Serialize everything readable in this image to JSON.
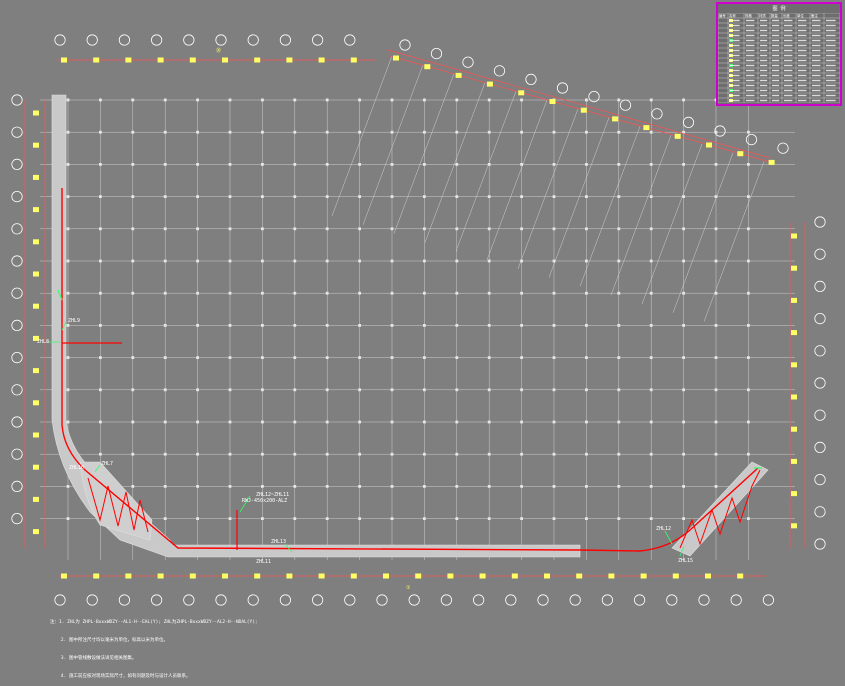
{
  "colors": {
    "background": "#7f7f7f",
    "grid": "#d8d8d8",
    "axis_marker": "#ffffff",
    "dimension_line": "#ff5050",
    "axis_tag": "#ffff66",
    "trench_fill": "#c9c9c9",
    "pipe": "#ff0000",
    "label_leader": "#33ff66",
    "legend_border": "#d000d0"
  },
  "legend": {
    "title": "图 例",
    "headers": [
      "编号",
      "名称",
      "规格",
      "材质",
      "数量",
      "长度",
      "单位",
      "备注"
    ]
  },
  "labels": {
    "l1": "ZHL8",
    "l2": "ZHL9",
    "l3": "ZHL7",
    "l4": "ZHL10",
    "l5": "ZHL12~ZHL11",
    "l6": "ZHL13",
    "l7": "ZHL11",
    "l8": "ZHL12",
    "l9": "ZHL14",
    "l10": "ZHL15",
    "l11": "RWJ-450x200-ALZ",
    "axis_top": "⑳",
    "axis_bottom": "①"
  },
  "notes": [
    "注：1. ZHL为 ZHPL-BxxxWDZY--AL1-H--EAL(Y); ZHL为ZHPL-BxxxWDZY--AL2-H--NDAL(Y);",
    "    2. 图中所注尺寸均以毫米为单位，标高以米为单位。",
    "    3. 图中管线敷设做法详见相关图集。",
    "    4. 施工前应核对现场实际尺寸，如有问题及时与设计人员联系。"
  ]
}
